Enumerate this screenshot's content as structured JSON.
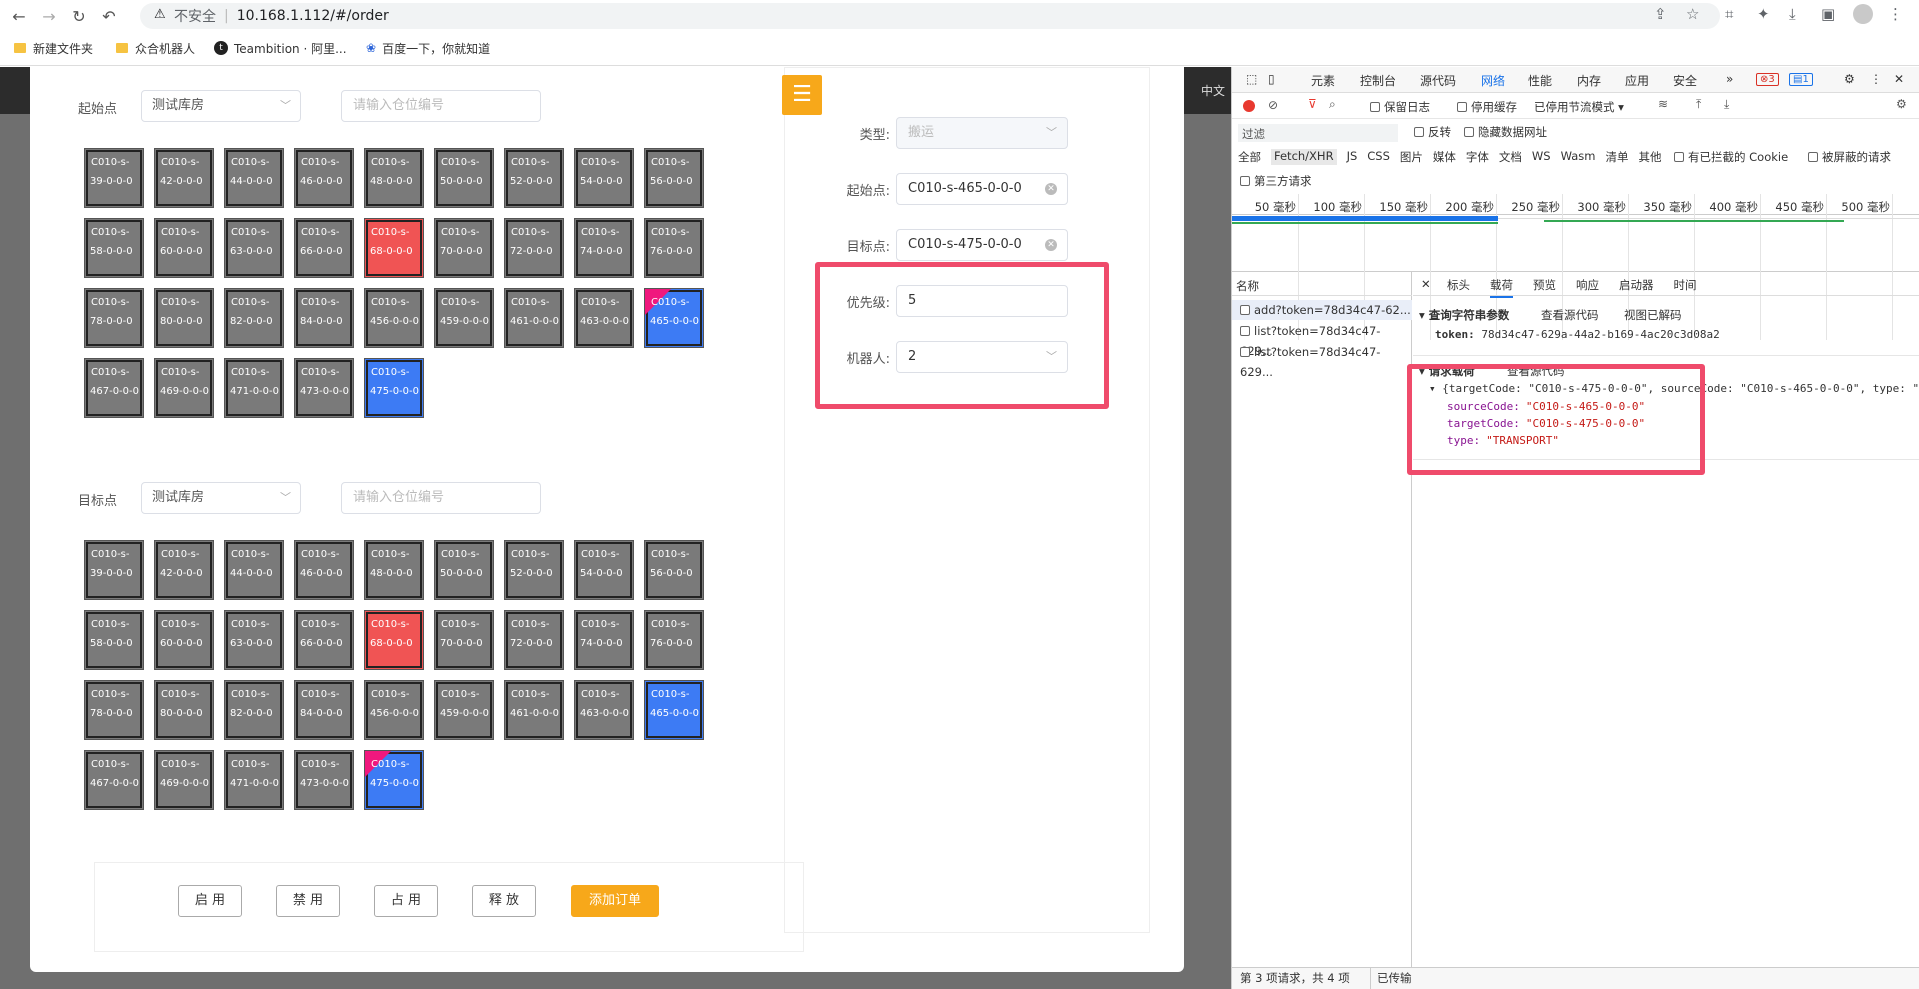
{
  "browser": {
    "security_label": "不安全",
    "url": "10.168.1.112/#/order",
    "bookmarks": [
      "新建文件夹",
      "众合机器人",
      "Teambition · 阿里...",
      "百度一下，你就知道"
    ]
  },
  "app": {
    "corner_lang": "中文"
  },
  "source": {
    "label": "起始点",
    "warehouse": "测试库房",
    "search_placeholder": "请输入仓位编号",
    "locations": [
      {
        "line1": "C010-s-",
        "line2": "39-0-0-0",
        "state": "gray"
      },
      {
        "line1": "C010-s-",
        "line2": "42-0-0-0",
        "state": "gray"
      },
      {
        "line1": "C010-s-",
        "line2": "44-0-0-0",
        "state": "gray"
      },
      {
        "line1": "C010-s-",
        "line2": "46-0-0-0",
        "state": "gray"
      },
      {
        "line1": "C010-s-",
        "line2": "48-0-0-0",
        "state": "gray"
      },
      {
        "line1": "C010-s-",
        "line2": "50-0-0-0",
        "state": "gray"
      },
      {
        "line1": "C010-s-",
        "line2": "52-0-0-0",
        "state": "gray"
      },
      {
        "line1": "C010-s-",
        "line2": "54-0-0-0",
        "state": "gray"
      },
      {
        "line1": "C010-s-",
        "line2": "56-0-0-0",
        "state": "gray"
      },
      {
        "line1": "C010-s-",
        "line2": "58-0-0-0",
        "state": "gray"
      },
      {
        "line1": "C010-s-",
        "line2": "60-0-0-0",
        "state": "gray"
      },
      {
        "line1": "C010-s-",
        "line2": "63-0-0-0",
        "state": "gray"
      },
      {
        "line1": "C010-s-",
        "line2": "66-0-0-0",
        "state": "gray"
      },
      {
        "line1": "C010-s-",
        "line2": "68-0-0-0",
        "state": "red"
      },
      {
        "line1": "C010-s-",
        "line2": "70-0-0-0",
        "state": "gray"
      },
      {
        "line1": "C010-s-",
        "line2": "72-0-0-0",
        "state": "gray"
      },
      {
        "line1": "C010-s-",
        "line2": "74-0-0-0",
        "state": "gray"
      },
      {
        "line1": "C010-s-",
        "line2": "76-0-0-0",
        "state": "gray"
      },
      {
        "line1": "C010-s-",
        "line2": "78-0-0-0",
        "state": "gray"
      },
      {
        "line1": "C010-s-",
        "line2": "80-0-0-0",
        "state": "gray"
      },
      {
        "line1": "C010-s-",
        "line2": "82-0-0-0",
        "state": "gray"
      },
      {
        "line1": "C010-s-",
        "line2": "84-0-0-0",
        "state": "gray"
      },
      {
        "line1": "C010-s-",
        "line2": "456-0-0-0",
        "state": "gray"
      },
      {
        "line1": "C010-s-",
        "line2": "459-0-0-0",
        "state": "gray"
      },
      {
        "line1": "C010-s-",
        "line2": "461-0-0-0",
        "state": "gray"
      },
      {
        "line1": "C010-s-",
        "line2": "463-0-0-0",
        "state": "gray"
      },
      {
        "line1": "C010-s-",
        "line2": "465-0-0-0",
        "state": "blue",
        "selected": true
      },
      {
        "line1": "C010-s-",
        "line2": "467-0-0-0",
        "state": "gray"
      },
      {
        "line1": "C010-s-",
        "line2": "469-0-0-0",
        "state": "gray"
      },
      {
        "line1": "C010-s-",
        "line2": "471-0-0-0",
        "state": "gray"
      },
      {
        "line1": "C010-s-",
        "line2": "473-0-0-0",
        "state": "gray"
      },
      {
        "line1": "C010-s-",
        "line2": "475-0-0-0",
        "state": "blue"
      }
    ]
  },
  "target": {
    "label": "目标点",
    "warehouse": "测试库房",
    "search_placeholder": "请输入仓位编号",
    "locations": [
      {
        "line1": "C010-s-",
        "line2": "39-0-0-0",
        "state": "gray"
      },
      {
        "line1": "C010-s-",
        "line2": "42-0-0-0",
        "state": "gray"
      },
      {
        "line1": "C010-s-",
        "line2": "44-0-0-0",
        "state": "gray"
      },
      {
        "line1": "C010-s-",
        "line2": "46-0-0-0",
        "state": "gray"
      },
      {
        "line1": "C010-s-",
        "line2": "48-0-0-0",
        "state": "gray"
      },
      {
        "line1": "C010-s-",
        "line2": "50-0-0-0",
        "state": "gray"
      },
      {
        "line1": "C010-s-",
        "line2": "52-0-0-0",
        "state": "gray"
      },
      {
        "line1": "C010-s-",
        "line2": "54-0-0-0",
        "state": "gray"
      },
      {
        "line1": "C010-s-",
        "line2": "56-0-0-0",
        "state": "gray"
      },
      {
        "line1": "C010-s-",
        "line2": "58-0-0-0",
        "state": "gray"
      },
      {
        "line1": "C010-s-",
        "line2": "60-0-0-0",
        "state": "gray"
      },
      {
        "line1": "C010-s-",
        "line2": "63-0-0-0",
        "state": "gray"
      },
      {
        "line1": "C010-s-",
        "line2": "66-0-0-0",
        "state": "gray"
      },
      {
        "line1": "C010-s-",
        "line2": "68-0-0-0",
        "state": "red"
      },
      {
        "line1": "C010-s-",
        "line2": "70-0-0-0",
        "state": "gray"
      },
      {
        "line1": "C010-s-",
        "line2": "72-0-0-0",
        "state": "gray"
      },
      {
        "line1": "C010-s-",
        "line2": "74-0-0-0",
        "state": "gray"
      },
      {
        "line1": "C010-s-",
        "line2": "76-0-0-0",
        "state": "gray"
      },
      {
        "line1": "C010-s-",
        "line2": "78-0-0-0",
        "state": "gray"
      },
      {
        "line1": "C010-s-",
        "line2": "80-0-0-0",
        "state": "gray"
      },
      {
        "line1": "C010-s-",
        "line2": "82-0-0-0",
        "state": "gray"
      },
      {
        "line1": "C010-s-",
        "line2": "84-0-0-0",
        "state": "gray"
      },
      {
        "line1": "C010-s-",
        "line2": "456-0-0-0",
        "state": "gray"
      },
      {
        "line1": "C010-s-",
        "line2": "459-0-0-0",
        "state": "gray"
      },
      {
        "line1": "C010-s-",
        "line2": "461-0-0-0",
        "state": "gray"
      },
      {
        "line1": "C010-s-",
        "line2": "463-0-0-0",
        "state": "gray"
      },
      {
        "line1": "C010-s-",
        "line2": "465-0-0-0",
        "state": "blue"
      },
      {
        "line1": "C010-s-",
        "line2": "467-0-0-0",
        "state": "gray"
      },
      {
        "line1": "C010-s-",
        "line2": "469-0-0-0",
        "state": "gray"
      },
      {
        "line1": "C010-s-",
        "line2": "471-0-0-0",
        "state": "gray"
      },
      {
        "line1": "C010-s-",
        "line2": "473-0-0-0",
        "state": "gray"
      },
      {
        "line1": "C010-s-",
        "line2": "475-0-0-0",
        "state": "blue",
        "selected": true
      }
    ]
  },
  "actions": {
    "enable": "启 用",
    "disable": "禁 用",
    "occupy": "占 用",
    "release": "释 放",
    "add_order": "添加订单"
  },
  "form": {
    "type_label": "类型:",
    "type_value": "搬运",
    "source_label": "起始点:",
    "source_value": "C010-s-465-0-0-0",
    "target_label": "目标点:",
    "target_value": "C010-s-475-0-0-0",
    "priority_label": "优先级:",
    "priority_value": "5",
    "robot_label": "机器人:",
    "robot_value": "2"
  },
  "devtools": {
    "tabs": [
      "元素",
      "控制台",
      "源代码",
      "网络",
      "性能",
      "内存",
      "应用",
      "安全"
    ],
    "active_tab": "网络",
    "error_count": "3",
    "message_count": "1",
    "preserve_log": "保留日志",
    "disable_cache": "停用缓存",
    "throttle": "已停用节流模式",
    "filter_placeholder": "过滤",
    "invert": "反转",
    "hide_data_urls": "隐藏数据网址",
    "type_filters": [
      "全部",
      "Fetch/XHR",
      "JS",
      "CSS",
      "图片",
      "媒体",
      "字体",
      "文档",
      "WS",
      "Wasm",
      "清单",
      "其他"
    ],
    "blocked_cookies": "有已拦截的 Cookie",
    "blocked_requests": "被屏蔽的请求",
    "third_party": "第三方请求",
    "timeline_ticks": [
      "50 毫秒",
      "100 毫秒",
      "150 毫秒",
      "200 毫秒",
      "250 毫秒",
      "300 毫秒",
      "350 毫秒",
      "400 毫秒",
      "450 毫秒",
      "500 毫秒"
    ],
    "name_header": "名称",
    "requests": [
      "add?token=78d34c47-62...",
      "list?token=78d34c47-629...",
      "list?token=78d34c47-629..."
    ],
    "detail_tabs": [
      "标头",
      "载荷",
      "预览",
      "响应",
      "启动器",
      "时间"
    ],
    "active_detail_tab": "载荷",
    "query_section": "查询字符串参数",
    "view_source": "查看源代码",
    "view_decoded": "视图已解码",
    "token_key": "token:",
    "token_value": "78d34c47-629a-44a2-b169-4ac20c3d08a2",
    "payload_section": "请求载荷",
    "payload_summary": "{targetCode: \"C010-s-475-0-0-0\", sourceCode: \"C010-s-465-0-0-0\", type: \"T",
    "payload_fields": [
      {
        "key": "sourceCode:",
        "value": "\"C010-s-465-0-0-0\""
      },
      {
        "key": "targetCode:",
        "value": "\"C010-s-475-0-0-0\""
      },
      {
        "key": "type:",
        "value": "\"TRANSPORT\""
      }
    ],
    "status_text": "第 3 项请求，共 4 项",
    "status_transfer": "已传输"
  },
  "colors": {
    "accent": "#f7a81a",
    "highlight": "#ef4b6b",
    "cell_gray": "#7a7a7a",
    "cell_red": "#f05454",
    "cell_blue": "#3d7bf4",
    "marker": "#f0187e"
  }
}
